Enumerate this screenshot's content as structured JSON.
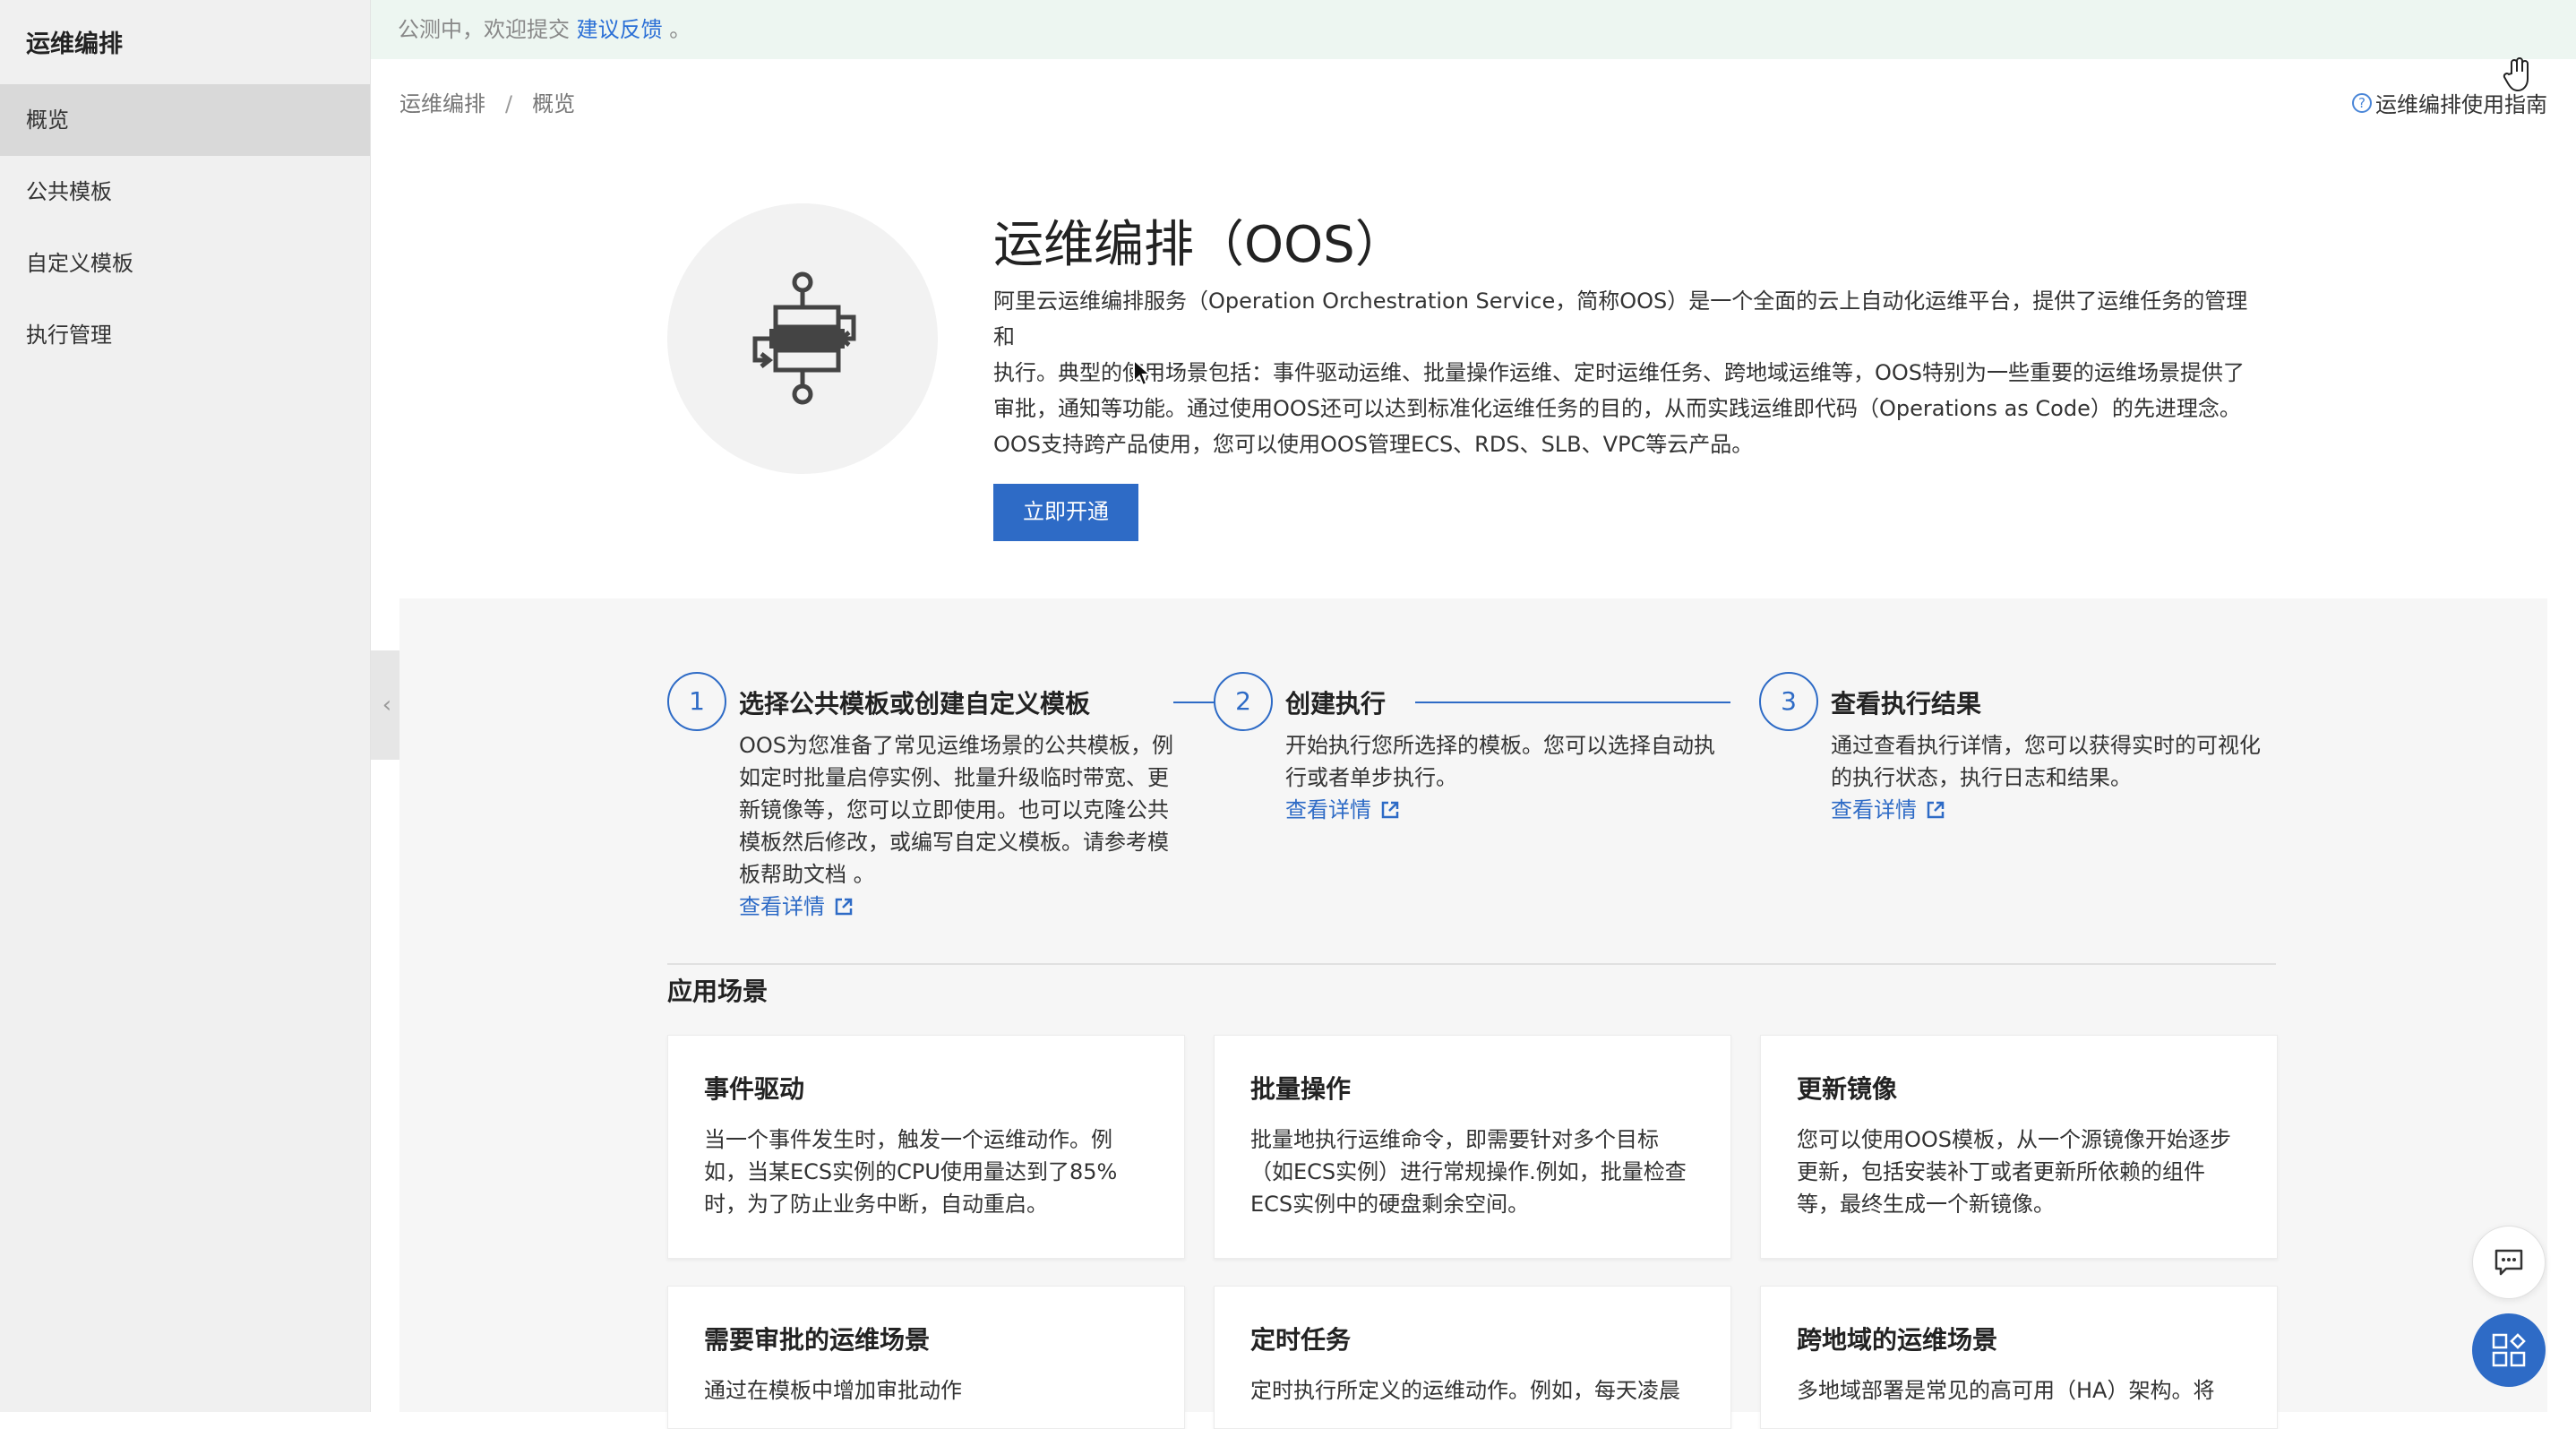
{
  "sidebar": {
    "title": "运维编排",
    "items": [
      {
        "label": "概览",
        "active": true
      },
      {
        "label": "公共模板"
      },
      {
        "label": "自定义模板"
      },
      {
        "label": "执行管理"
      }
    ],
    "collapse_icon": "chevron-left-icon"
  },
  "notice": {
    "text": "公测中，欢迎提交",
    "link": "建议反馈",
    "suffix": "。"
  },
  "breadcrumb": {
    "items": [
      "运维编排",
      "概览"
    ],
    "separator": "/"
  },
  "guide": {
    "label": "运维编排使用指南",
    "icon": "question-circle-icon"
  },
  "hero": {
    "title": "运维编排（OOS）",
    "description_lines": [
      "阿里云运维编排服务（Operation Orchestration Service，简称OOS）是一个全面的云上自动化运维平台，提供了运维任务的管理和",
      "执行。典型的使用场景包括：事件驱动运维、批量操作运维、定时运维任务、跨地域运维等，OOS特别为一些重要的运维场景提供了",
      "审批，通知等功能。通过使用OOS还可以达到标准化运维任务的目的，从而实践运维即代码（Operations as Code）的先进理念。",
      "OOS支持跨产品使用，您可以使用OOS管理ECS、RDS、SLB、VPC等云产品。"
    ],
    "button": "立即开通",
    "icon": "workflow-icon"
  },
  "steps": [
    {
      "number": "1",
      "title": "选择公共模板或创建自定义模板",
      "description": "OOS为您准备了常见运维场景的公共模板，例如定时批量启停实例、批量升级临时带宽、更新镜像等，您可以立即使用。也可以克隆公共模板然后修改，或编写自定义模板。请参考模板帮助文档 。",
      "link": "查看详情"
    },
    {
      "number": "2",
      "title": "创建执行",
      "description": "开始执行您所选择的模板。您可以选择自动执行或者单步执行。",
      "link": "查看详情"
    },
    {
      "number": "3",
      "title": "查看执行结果",
      "description": "通过查看执行详情，您可以获得实时的可视化的执行状态，执行日志和结果。",
      "link": "查看详情"
    }
  ],
  "scenes": {
    "title": "应用场景",
    "cards": [
      {
        "title": "事件驱动",
        "description": "当一个事件发生时，触发一个运维动作。例如，当某ECS实例的CPU使用量达到了85%时，为了防止业务中断，自动重启。"
      },
      {
        "title": "批量操作",
        "description": "批量地执行运维命令，即需要针对多个目标（如ECS实例）进行常规操作.例如，批量检查ECS实例中的硬盘剩余空间。"
      },
      {
        "title": "更新镜像",
        "description": "您可以使用OOS模板，从一个源镜像开始逐步更新，包括安装补丁或者更新所依赖的组件等，最终生成一个新镜像。"
      },
      {
        "title": "需要审批的运维场景",
        "description": "通过在模板中增加审批动作"
      },
      {
        "title": "定时任务",
        "description": "定时执行所定义的运维动作。例如，每天凌晨"
      },
      {
        "title": "跨地域的运维场景",
        "description": "多地域部署是常见的高可用（HA）架构。将"
      }
    ]
  },
  "floating": {
    "chat_icon": "chat-icon",
    "apps_icon": "apps-icon"
  },
  "colors": {
    "accent": "#2e6bc6",
    "notice_bg": "#edf6f1",
    "sidebar_bg": "#f0f0f0",
    "panel_bg": "#f6f6f6"
  }
}
